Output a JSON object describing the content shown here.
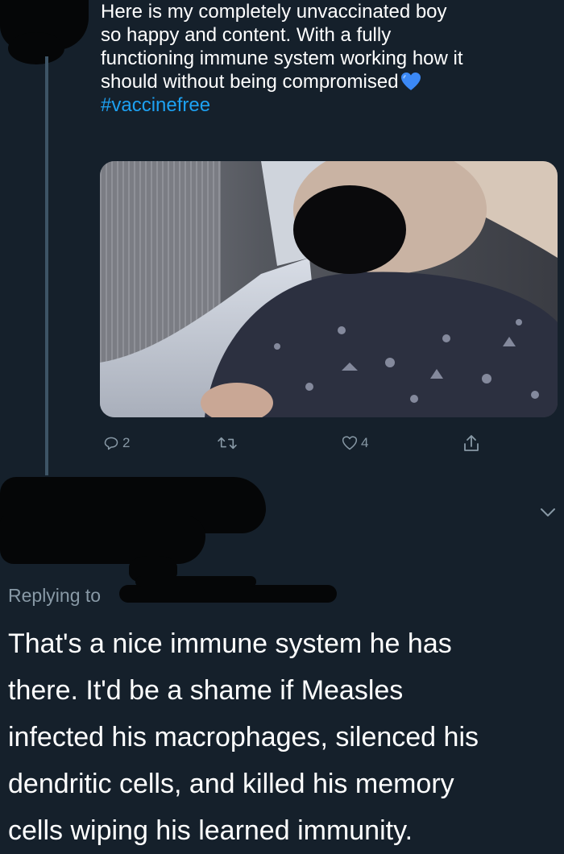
{
  "tweet": {
    "text_lines": [
      "Here is my completely unvaccinated boy",
      "so happy and content. With a fully",
      "functioning immune system working how it",
      "should without being compromised"
    ],
    "emoji": "blue-heart",
    "hashtag": "#vaccinefree",
    "media": {
      "description_icon": "photo"
    },
    "actions": {
      "reply_count": "2",
      "retweet_count": "",
      "like_count": "4"
    }
  },
  "reply": {
    "replying_to_label": "Replying to",
    "text_lines": [
      "That's a nice immune system he has",
      "there.  It'd be a shame if Measles",
      "infected his macrophages, silenced his",
      "dendritic cells, and killed his memory",
      "cells wiping his learned immunity."
    ]
  },
  "colors": {
    "background": "#15202b",
    "text": "#ffffff",
    "secondary_text": "#8899a6",
    "accent": "#1da1f2",
    "thread_line": "#3d5466",
    "heart_emoji": "#3b88f5"
  }
}
